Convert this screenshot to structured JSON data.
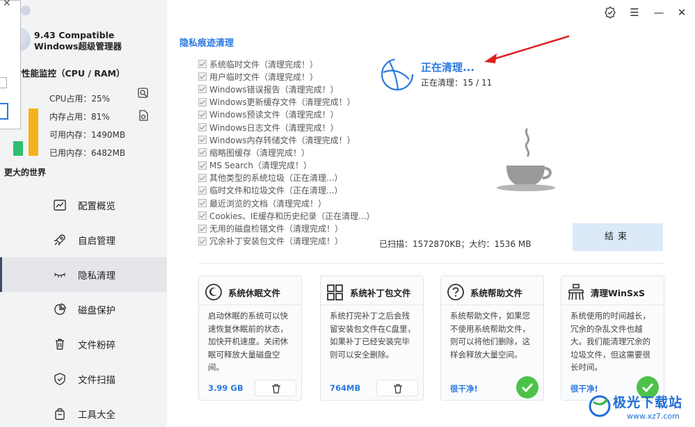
{
  "app": {
    "title_line1": "9.43 Compatible",
    "title_line2": "Windows超级管理器"
  },
  "monitor": {
    "title": "实时性能监控（CPU / RAM）",
    "cpu_label": "CPU占用：25%",
    "cpu_percent": 25,
    "mem_label": "内存占用：81%",
    "mem_percent": 81,
    "avail_label": "可用内存：1490MB",
    "used_label": "已用内存：6482MB",
    "slogan": "更大的世界",
    "cpu_bar_color": "#2fbf6f",
    "mem_bar_color": "#f6b21c"
  },
  "nav": [
    {
      "label": "配置概览",
      "icon": "chart-icon",
      "active": false
    },
    {
      "label": "自启管理",
      "icon": "rocket-icon",
      "active": false
    },
    {
      "label": "隐私清理",
      "icon": "eye-closed-icon",
      "active": true
    },
    {
      "label": "磁盘保护",
      "icon": "pie-icon",
      "active": false
    },
    {
      "label": "文件粉碎",
      "icon": "trash-icon",
      "active": false
    },
    {
      "label": "文件扫描",
      "icon": "shield-icon",
      "active": false
    },
    {
      "label": "工具大全",
      "icon": "bag-icon",
      "active": false
    }
  ],
  "main": {
    "section_title": "隐私痕迹清理",
    "items": [
      "系统临时文件（清理完成！）",
      "用户临时文件（清理完成！）",
      "Windows错误报告（清理完成！）",
      "Windows更新缓存文件（清理完成！）",
      "Windows预读文件（清理完成！）",
      "Windows日志文件（清理完成！）",
      "Windows内存转储文件（清理完成！）",
      "缩略图缓存（清理完成！）",
      "MS Search（清理完成！）",
      "其他类型的系统垃圾（正在清理...）",
      "临时文件和垃圾文件（正在清理...）",
      "最近浏览的文档（清理完成！）",
      "Cookies、IE缓存和历史纪录（正在清理...）",
      "无用的磁盘检错文件（清理完成！）",
      "冗余补丁安装包文件（清理完成！）"
    ],
    "status_title": "正在清理...",
    "status_progress": "正在清理：15 / 11",
    "scan_info": "已扫描：1572870KB；大约：1536 MB",
    "end_button": "结束",
    "accent_color": "#2b79e0"
  },
  "cards": [
    {
      "title": "系统休眠文件",
      "icon": "sleep-icon",
      "desc": "启动休眠的系统可以快速恢复休眠前的状态，加快开机速度。关闭休眠可释放大量磁盘空间。",
      "footer": "3.99 GB",
      "action": "trash"
    },
    {
      "title": "系统补丁包文件",
      "icon": "windows-grid-icon",
      "desc": "系统打完补丁之后会残留安装包文件在C盘里，如果补丁已经安装完毕则可以安全删除。",
      "footer": "764MB",
      "action": "trash"
    },
    {
      "title": "系统帮助文件",
      "icon": "question-icon",
      "desc": "系统帮助文件，如果您不使用系统帮助文件，则可以将他们删除，这样会释放大量空间。",
      "footer": "很干净!",
      "action": "check"
    },
    {
      "title": "清理WinSxS",
      "icon": "broom-icon",
      "desc": "系统使用的时间越长，冗余的杂乱文件也越大。我们能清理冗余的垃圾文件，但这需要很长时间。",
      "footer": "很干净!",
      "action": "check"
    }
  ],
  "watermark": {
    "line1": "极光下载站",
    "line2": "www.xz7.com"
  }
}
